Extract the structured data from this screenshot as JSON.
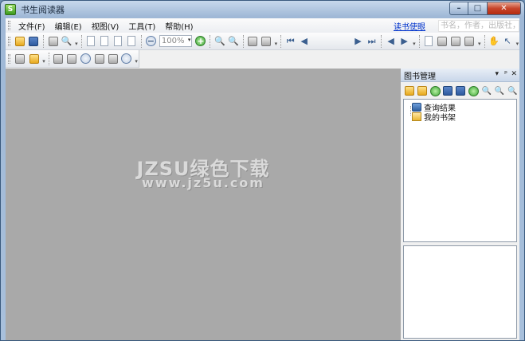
{
  "window": {
    "title": "书生阅读器",
    "app_icon_glyph": "S",
    "controls": {
      "minimize": "–",
      "maximize": "□",
      "close": "✕"
    }
  },
  "menubar": {
    "items": [
      {
        "label": "文件(F)"
      },
      {
        "label": "编辑(E)"
      },
      {
        "label": "视图(V)"
      },
      {
        "label": "工具(T)"
      },
      {
        "label": "帮助(H)"
      }
    ],
    "read_link": "读书使眼",
    "search_placeholder": "书名，作者，出版社，类"
  },
  "toolbar": {
    "zoom_value": "100%",
    "zoom_arrow": "▾",
    "overflow_glyph": "▾",
    "nav": {
      "first": "⏮",
      "prev": "◀",
      "next": "▶",
      "last": "⏭"
    },
    "hand_glyph": "✋",
    "cursor_glyph": "↖",
    "zoom_out_glyph": "−",
    "zoom_in_glyph": "+",
    "magnify_glyph": "🔍"
  },
  "watermark": {
    "line1": "JZSU绿色下载",
    "line2": "www.jz5u.com"
  },
  "panel": {
    "title": "图书管理",
    "controls": {
      "dropdown": "▾",
      "pin": "ᵖ",
      "close": "✕"
    },
    "tree": [
      {
        "label": "查询结果"
      },
      {
        "label": "我的书架"
      }
    ]
  },
  "colors": {
    "document_bg": "#a9a9a9",
    "title_bar": "#9fb8d6",
    "link": "#0033cc",
    "close_button": "#c7452b"
  }
}
